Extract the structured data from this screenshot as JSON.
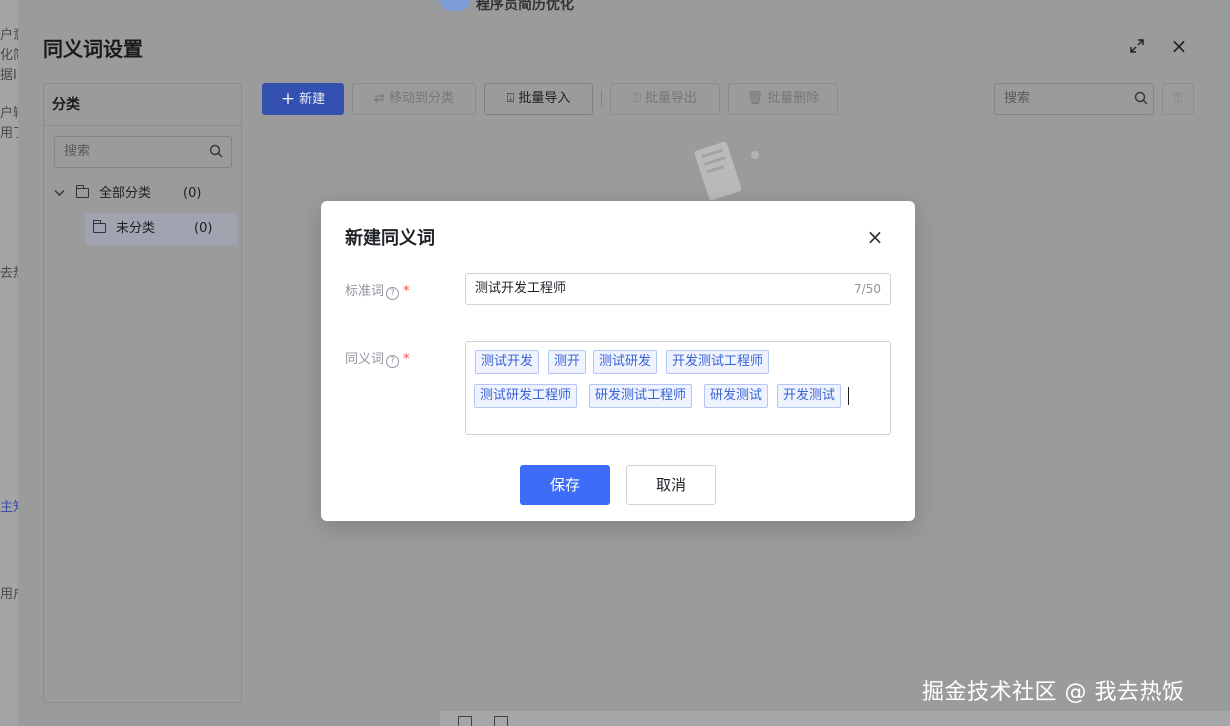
{
  "background": {
    "top_title": "程序员简历优化",
    "left_fragments": [
      "户意",
      "化简",
      "据I",
      "户输",
      "用了",
      "去热",
      "主知",
      "用户"
    ]
  },
  "settings": {
    "title": "同义词设置",
    "category_panel": {
      "header": "分类",
      "search_placeholder": "搜索",
      "tree": [
        {
          "label": "全部分类",
          "count": "(0)",
          "expanded": true
        },
        {
          "label": "未分类",
          "count": "(0)",
          "selected": true
        }
      ]
    },
    "toolbar": {
      "new_label": "新建",
      "move_label": "移动到分类",
      "import_label": "批量导入",
      "export_label": "批量导出",
      "delete_label": "批量删除",
      "search_placeholder": "搜索"
    }
  },
  "modal": {
    "title": "新建同义词",
    "standard_word": {
      "label": "标准词",
      "value": "测试开发工程师",
      "count": "7/50"
    },
    "synonyms": {
      "label": "同义词",
      "tags": [
        "测试开发",
        "测开",
        "测试研发",
        "开发测试工程师",
        "测试研发工程师",
        "研发测试工程师",
        "研发测试",
        "开发测试"
      ]
    },
    "save_label": "保存",
    "cancel_label": "取消"
  },
  "watermark": "掘金技术社区 @ 我去热饭",
  "colors": {
    "primary": "#3d6df8",
    "tag_text": "#3a63d8",
    "tag_bg": "#eef3fe",
    "required": "#f54a45"
  }
}
